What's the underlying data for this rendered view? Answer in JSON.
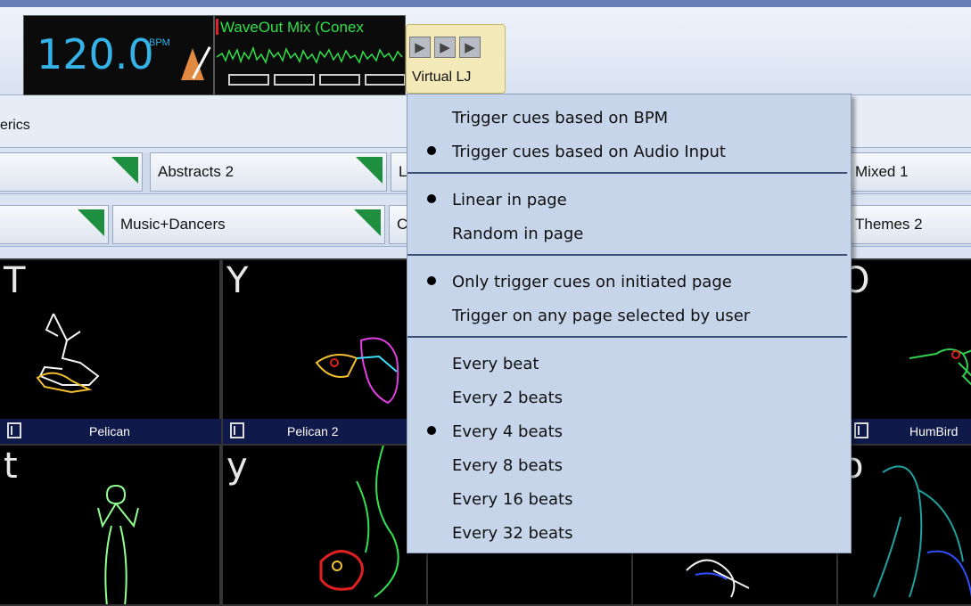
{
  "bpm": {
    "value": "120.0",
    "unit": "BPM"
  },
  "audio_input": {
    "label": "WaveOut Mix (Conex"
  },
  "virtual_lj": {
    "label": "Virtual LJ"
  },
  "tabs_bar": {
    "label": "erics"
  },
  "page_tabs_row1": [
    {
      "label": ""
    },
    {
      "label": "Abstracts 2"
    },
    {
      "label": "L"
    },
    {
      "label": "Mixed 1"
    }
  ],
  "page_tabs_row2": [
    {
      "label": ""
    },
    {
      "label": "Music+Dancers"
    },
    {
      "label": "C"
    },
    {
      "label": "Themes 2"
    }
  ],
  "cues_row1": [
    {
      "key": "T",
      "name": "Pelican"
    },
    {
      "key": "Y",
      "name": "Pelican 2"
    },
    {
      "key": "O",
      "name": "HumBird"
    }
  ],
  "cues_row2": [
    {
      "key": "t"
    },
    {
      "key": "y"
    },
    {
      "key": "o"
    }
  ],
  "menu": {
    "items": [
      {
        "label": "Trigger cues based on BPM",
        "checked": false
      },
      {
        "label": "Trigger cues based on Audio Input",
        "checked": true
      },
      {
        "label": "Linear in page",
        "checked": true
      },
      {
        "label": "Random in page",
        "checked": false
      },
      {
        "label": "Only trigger cues on initiated page",
        "checked": true
      },
      {
        "label": "Trigger on any page selected by user",
        "checked": false
      },
      {
        "label": "Every beat",
        "checked": false
      },
      {
        "label": "Every 2 beats",
        "checked": false
      },
      {
        "label": "Every 4 beats",
        "checked": true
      },
      {
        "label": "Every 8 beats",
        "checked": false
      },
      {
        "label": "Every 16 beats",
        "checked": false
      },
      {
        "label": "Every 32 beats",
        "checked": false
      }
    ]
  },
  "colors": {
    "bpm_text": "#34b3e8",
    "waveform": "#2fe04a",
    "tab_corner": "#1e8f3e",
    "menu_bg": "#c6d5ea",
    "virtual_lj_bg": "#f4e9b8"
  }
}
